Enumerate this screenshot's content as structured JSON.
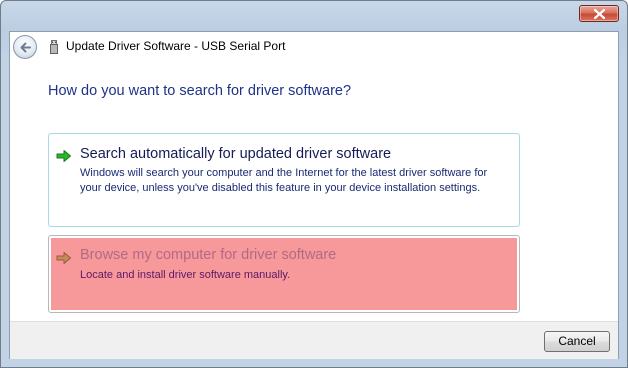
{
  "window": {
    "title": "Update Driver Software - USB Serial Port"
  },
  "main": {
    "question": "How do you want to search for driver software?",
    "options": [
      {
        "title": "Search automatically for updated driver software",
        "description": "Windows will search your computer and the Internet for the latest driver software for your device, unless you've disabled this feature in your device installation settings.",
        "icon": "green-arrow-icon"
      },
      {
        "title": "Browse my computer for driver software",
        "description": "Locate and install driver software manually.",
        "icon": "green-arrow-icon",
        "highlight_color": "#f7989b"
      }
    ]
  },
  "footer": {
    "cancel_label": "Cancel"
  },
  "icons": {
    "close": "close-icon",
    "back": "back-arrow-icon",
    "device": "usb-device-icon"
  }
}
